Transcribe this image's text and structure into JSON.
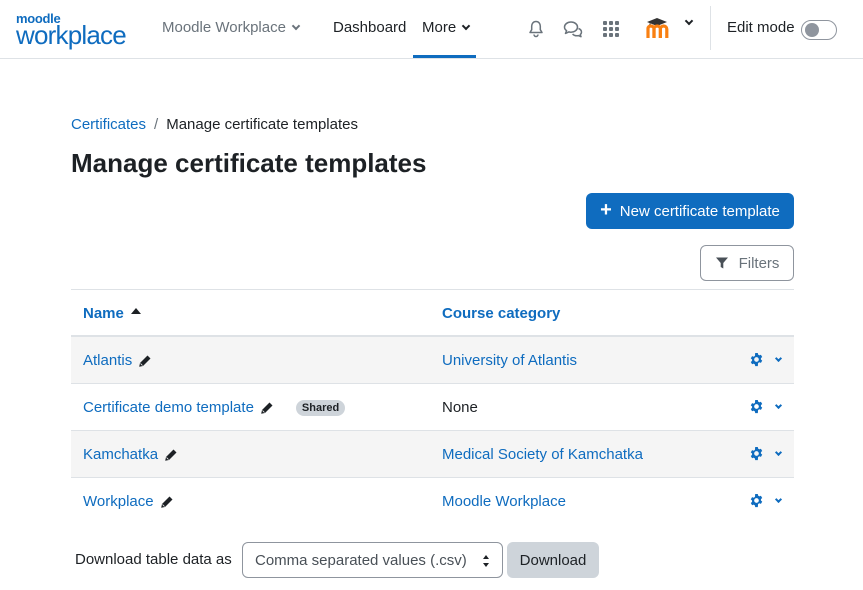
{
  "navbar": {
    "logo_top": "moodle",
    "logo_bottom": "workplace",
    "site_menu": "Moodle Workplace",
    "links": {
      "dashboard": "Dashboard",
      "more": "More"
    },
    "edit_mode_label": "Edit mode",
    "edit_mode_on": false
  },
  "breadcrumb": {
    "parent": "Certificates",
    "separator": "/",
    "current": "Manage certificate templates"
  },
  "page_title": "Manage certificate templates",
  "actions": {
    "new_template_label": "New certificate template",
    "filters_label": "Filters"
  },
  "table": {
    "columns": {
      "name": "Name",
      "category": "Course category"
    },
    "rows": [
      {
        "name": "Atlantis",
        "category": "University of Atlantis",
        "category_link": true,
        "badge": ""
      },
      {
        "name": "Certificate demo template",
        "category": "None",
        "category_link": false,
        "badge": "Shared"
      },
      {
        "name": "Kamchatka",
        "category": "Medical Society of Kamchatka",
        "category_link": true,
        "badge": ""
      },
      {
        "name": "Workplace",
        "category": "Moodle Workplace",
        "category_link": true,
        "badge": ""
      }
    ]
  },
  "download": {
    "label": "Download table data as",
    "format_selected": "Comma separated values (.csv)",
    "button_label": "Download"
  },
  "colors": {
    "primary": "#0f6cbf",
    "text": "#1d2125",
    "muted": "#6a737b",
    "border": "#dee2e6",
    "stripe": "#f5f5f5",
    "avatar_orange": "#f98012"
  }
}
